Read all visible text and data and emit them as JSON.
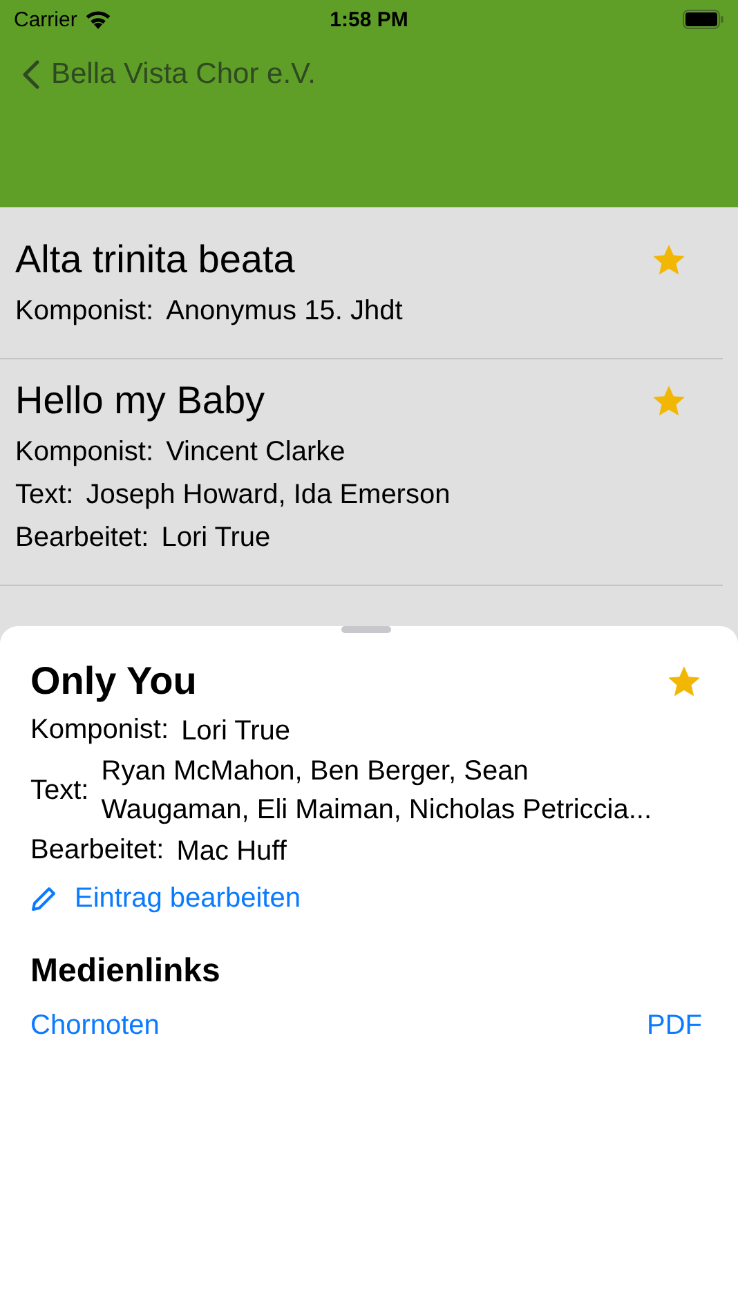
{
  "status_bar": {
    "carrier": "Carrier",
    "time": "1:58 PM"
  },
  "nav": {
    "back_label": "Bella Vista Chor e.V."
  },
  "songs": [
    {
      "title": "Alta trinita beata",
      "favorite": true,
      "credits": [
        {
          "label": "Komponist:",
          "value": "Anonymus 15. Jhdt"
        }
      ]
    },
    {
      "title": "Hello my Baby",
      "favorite": true,
      "credits": [
        {
          "label": "Komponist:",
          "value": "Vincent Clarke"
        },
        {
          "label": "Text:",
          "value": "Joseph Howard, Ida Emerson"
        },
        {
          "label": "Bearbeitet:",
          "value": "Lori True"
        }
      ]
    }
  ],
  "detail": {
    "title": "Only You",
    "favorite": true,
    "credits": [
      {
        "label": "Komponist:",
        "value": "Lori True"
      },
      {
        "label": "Text:",
        "value": "Ryan McMahon, Ben Berger, Sean Waugaman, Eli Maiman, Nicholas Petriccia..."
      },
      {
        "label": "Bearbeitet:",
        "value": "Mac Huff"
      }
    ],
    "edit_link": "Eintrag bearbeiten",
    "media": {
      "heading": "Medienlinks",
      "links": [
        "Chornoten",
        "PDF"
      ]
    }
  }
}
